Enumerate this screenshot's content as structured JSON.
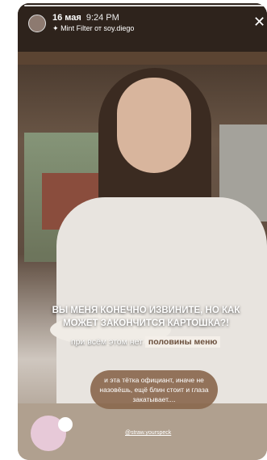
{
  "story": {
    "date": "16 мая",
    "time": "9:24 PM",
    "filter_line": "Mint Filter от soy.diego",
    "filter_icon": "sparkle-icon",
    "close_icon": "close-icon"
  },
  "captions": {
    "headline": "ВЫ МЕНЯ КОНЕЧНО ИЗВИНИТЕ, НО КАК МОЖЕТ ЗАКОНЧИТСЯ КАРТОШКА?!",
    "sub_plain": "при всём этом нет",
    "sub_highlight": "половины меню",
    "bubble": "и эта тётка официант, иначе не назовёшь, ещё блин стоит и глаза закатывает....",
    "handle": "@straw.yourspeck"
  }
}
